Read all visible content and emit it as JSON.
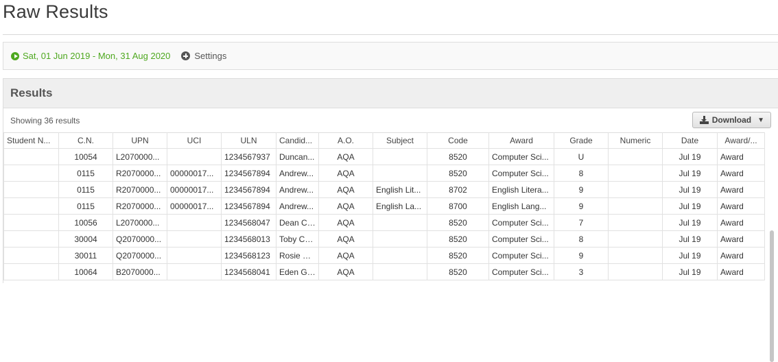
{
  "page": {
    "title": "Raw Results"
  },
  "filters": {
    "date_range": "Sat, 01 Jun 2019 - Mon, 31 Aug 2020",
    "settings_label": "Settings"
  },
  "results": {
    "title": "Results",
    "showing": "Showing 36 results",
    "download_label": "Download",
    "columns": [
      "Student N...",
      "C.N.",
      "UPN",
      "UCI",
      "ULN",
      "Candid...",
      "A.O.",
      "Subject",
      "Code",
      "Award",
      "Grade",
      "Numeric",
      "Date",
      "Award/..."
    ],
    "rows": [
      [
        "",
        "10054",
        "L2070000...",
        "",
        "1234567937",
        "Duncan...",
        "AQA",
        "",
        "8520",
        "Computer Sci...",
        "U",
        "",
        "Jul 19",
        "Award"
      ],
      [
        "",
        "0115",
        "R2070000...",
        "00000017...",
        "1234567894",
        "Andrew...",
        "AQA",
        "",
        "8520",
        "Computer Sci...",
        "8",
        "",
        "Jul 19",
        "Award"
      ],
      [
        "",
        "0115",
        "R2070000...",
        "00000017...",
        "1234567894",
        "Andrew...",
        "AQA",
        "English Lit...",
        "8702",
        "English Litera...",
        "9",
        "",
        "Jul 19",
        "Award"
      ],
      [
        "",
        "0115",
        "R2070000...",
        "00000017...",
        "1234567894",
        "Andrew...",
        "AQA",
        "English La...",
        "8700",
        "English Lang...",
        "9",
        "",
        "Jul 19",
        "Award"
      ],
      [
        "",
        "10056",
        "L2070000...",
        "",
        "1234568047",
        "Dean Cl...",
        "AQA",
        "",
        "8520",
        "Computer Sci...",
        "7",
        "",
        "Jul 19",
        "Award"
      ],
      [
        "",
        "30004",
        "Q2070000...",
        "",
        "1234568013",
        "Toby Co...",
        "AQA",
        "",
        "8520",
        "Computer Sci...",
        "8",
        "",
        "Jul 19",
        "Award"
      ],
      [
        "",
        "30011",
        "Q2070000...",
        "",
        "1234568123",
        "Rosie G...",
        "AQA",
        "",
        "8520",
        "Computer Sci...",
        "9",
        "",
        "Jul 19",
        "Award"
      ],
      [
        "",
        "10064",
        "B2070000...",
        "",
        "1234568041",
        "Eden Gr...",
        "AQA",
        "",
        "8520",
        "Computer Sci...",
        "3",
        "",
        "Jul 19",
        "Award"
      ]
    ]
  },
  "colors": {
    "accent_green": "#4ea81f"
  }
}
